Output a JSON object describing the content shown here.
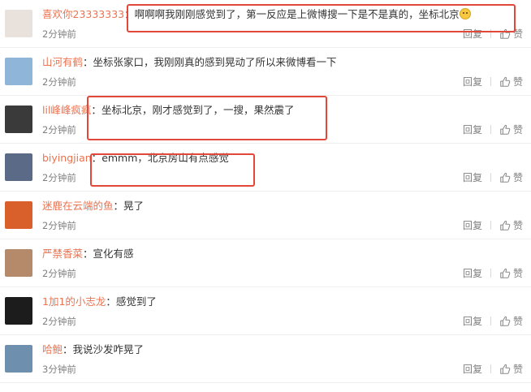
{
  "comments": [
    {
      "user": "喜欢你23333333",
      "sep": "：",
      "text": "啊啊啊我刚刚感觉到了，第一反应是上微博搜一下是不是真的，坐标北京",
      "time": "2分钟前",
      "avatar_color": "#e9e1dc",
      "has_emoji": true
    },
    {
      "user": "山河有鹤",
      "sep": "：",
      "text": "坐标张家口，我刚刚真的感到晃动了所以来微博看一下",
      "time": "2分钟前",
      "avatar_color": "#8fb6d8",
      "has_emoji": false
    },
    {
      "user": "lil峰峰疯疯",
      "sep": "：",
      "text": "坐标北京，刚才感觉到了，一搜，果然震了",
      "time": "2分钟前",
      "avatar_color": "#3a3a3a",
      "has_emoji": false
    },
    {
      "user": "biyingjian",
      "sep": "：",
      "text": "emmm，北京房山有点感觉",
      "time": "2分钟前",
      "avatar_color": "#5b6a86",
      "has_emoji": false
    },
    {
      "user": "迷鹿在云端的鱼",
      "sep": "：",
      "text": "晃了",
      "time": "2分钟前",
      "avatar_color": "#d9602a",
      "has_emoji": false
    },
    {
      "user": "严禁香菜",
      "sep": "：",
      "text": "宣化有感",
      "time": "2分钟前",
      "avatar_color": "#b48a6a",
      "has_emoji": false
    },
    {
      "user": "1加1的小志龙",
      "sep": "：",
      "text": "感觉到了",
      "time": "2分钟前",
      "avatar_color": "#1c1c1c",
      "has_emoji": false
    },
    {
      "user": "哈鲍",
      "sep": "：",
      "text": "我说沙发咋晃了",
      "time": "3分钟前",
      "avatar_color": "#6f8fae",
      "has_emoji": false
    }
  ],
  "reply_label": "回复",
  "like_label": "赞",
  "highlight_color": "#e2483a"
}
